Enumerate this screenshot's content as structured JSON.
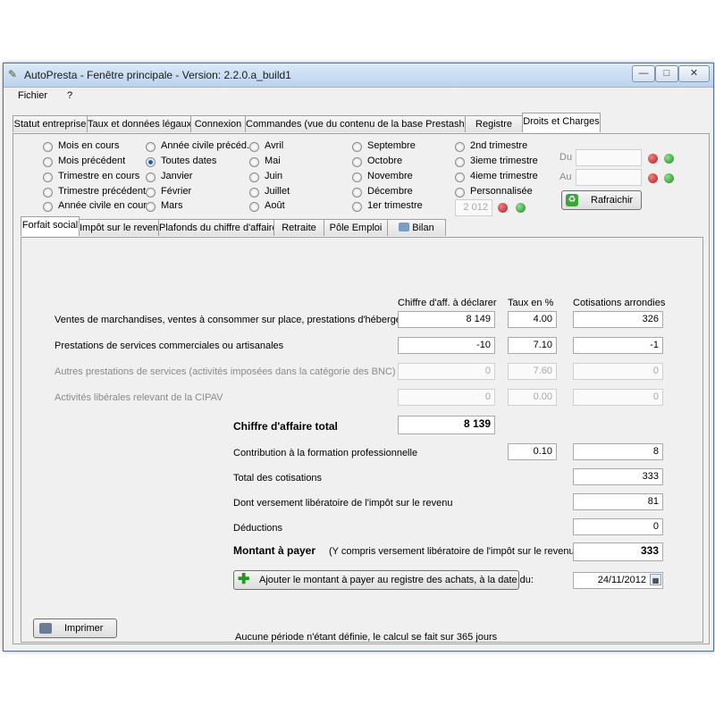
{
  "window": {
    "title": "AutoPresta - Fenêtre principale  -  Version:  2.2.0.a_build1",
    "minimize": "—",
    "maximize": "□",
    "close": "✕"
  },
  "menu": {
    "items": [
      "Fichier",
      "?"
    ]
  },
  "main_tabs": [
    "Statut entreprise",
    "Taux et données légaux",
    "Connexion",
    "Commandes (vue du contenu de la base Prestashop)",
    "Registre",
    "Droits et Charges"
  ],
  "periods": {
    "col1": [
      "Mois en cours",
      "Mois précédent",
      "Trimestre en cours",
      "Trimestre précédent",
      "Année civile en cours"
    ],
    "col2": [
      "Année civile précéd.",
      "Toutes dates",
      "Janvier",
      "Février",
      "Mars"
    ],
    "col3": [
      "Avril",
      "Mai",
      "Juin",
      "Juillet",
      "Août"
    ],
    "col4": [
      "Septembre",
      "Octobre",
      "Novembre",
      "Décembre",
      "1er trimestre"
    ],
    "col5": [
      "2nd trimestre",
      "3ieme trimestre",
      "4ieme trimestre",
      "Personnalisée"
    ],
    "selected": "Toutes dates",
    "year_value": "2 012",
    "du_label": "Du",
    "au_label": "Au",
    "refresh_label": "Rafraichir"
  },
  "sub_tabs": [
    "Forfait social",
    "Impôt sur le revenu",
    "Plafonds du chiffre d'affaire",
    "Retraite",
    "Pôle Emploi",
    "Bilan"
  ],
  "table": {
    "headers": {
      "ca": "Chiffre d'aff. à déclarer",
      "taux": "Taux en %",
      "cotis": "Cotisations arrondies"
    },
    "rows": [
      {
        "label": "Ventes de marchandises, ventes à consommer sur place, prestations d'hébergement",
        "ca": "8 149",
        "taux": "4.00",
        "cotis": "326",
        "disabled": false
      },
      {
        "label": "Prestations de services commerciales ou artisanales",
        "ca": "-10",
        "taux": "7.10",
        "cotis": "-1",
        "disabled": false
      },
      {
        "label": "Autres prestations de services (activités imposées dans la catégorie des BNC)",
        "ca": "0",
        "taux": "7.60",
        "cotis": "0",
        "disabled": true
      },
      {
        "label": "Activités libérales relevant de la CIPAV",
        "ca": "0",
        "taux": "0.00",
        "cotis": "0",
        "disabled": true
      }
    ]
  },
  "totals": {
    "ca_total_label": "Chiffre d'affaire total",
    "ca_total": "8 139",
    "formation_label": "Contribution à la formation professionnelle",
    "formation_taux": "0.10",
    "formation_value": "8",
    "total_cotis_label": "Total des cotisations",
    "total_cotis": "333",
    "versement_label": "Dont versement libératoire de l'impôt sur le revenu",
    "versement": "81",
    "deductions_label": "Déductions",
    "deductions": "0",
    "montant_label": "Montant à payer",
    "montant_note": "(Y compris versement libératoire de l'impôt sur le revenu)",
    "montant": "333"
  },
  "add_button_label": "Ajouter le montant à payer au registre des achats, à la date du:",
  "date_value": "24/11/2012",
  "print_label": "Imprimer",
  "status_text": "Aucune période n'étant définie, le calcul se fait sur 365 jours"
}
